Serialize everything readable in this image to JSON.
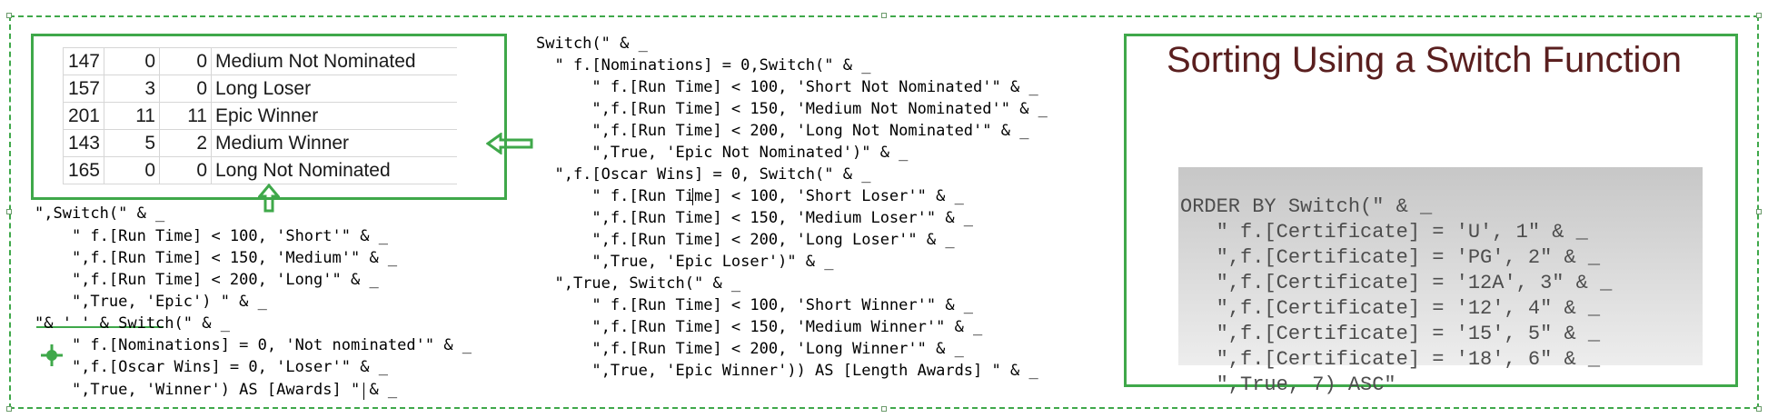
{
  "spreadsheet": {
    "rows": [
      [
        "147",
        "0",
        "0",
        "Medium Not Nominated"
      ],
      [
        "157",
        "3",
        "0",
        "Long Loser"
      ],
      [
        "201",
        "11",
        "11",
        "Epic Winner"
      ],
      [
        "143",
        "5",
        "2",
        "Medium Winner"
      ],
      [
        "165",
        "0",
        "0",
        "Long Not Nominated"
      ]
    ]
  },
  "left_code": [
    "\",Switch(\" & _",
    "    \" f.[Run Time] < 100, 'Short'\" & _",
    "    \",f.[Run Time] < 150, 'Medium'\" & _",
    "    \",f.[Run Time] < 200, 'Long'\" & _",
    "    \",True, 'Epic') \" & _",
    "\"& ' ' & Switch(\" & _",
    "    \" f.[Nominations] = 0, 'Not nominated'\" & _",
    "    \",f.[Oscar Wins] = 0, 'Loser'\" & _",
    "    \",True, 'Winner') AS [Awards] \" & _"
  ],
  "middle_code": [
    "Switch(\" & _",
    "  \" f.[Nominations] = 0,Switch(\" & _",
    "      \" f.[Run Time] < 100, 'Short Not Nominated'\" & _",
    "      \",f.[Run Time] < 150, 'Medium Not Nominated'\" & _",
    "      \",f.[Run Time] < 200, 'Long Not Nominated'\" & _",
    "      \",True, 'Epic Not Nominated')\" & _",
    "  \",f.[Oscar Wins] = 0, Switch(\" & _",
    "      \" f.[Run Time] < 100, 'Short Loser'\" & _",
    "      \",f.[Run Time] < 150, 'Medium Loser'\" & _",
    "      \",f.[Run Time] < 200, 'Long Loser'\" & _",
    "      \",True, 'Epic Loser')\" & _",
    "  \",True, Switch(\" & _",
    "      \" f.[Run Time] < 100, 'Short Winner'\" & _",
    "      \",f.[Run Time] < 150, 'Medium Winner'\" & _",
    "      \",f.[Run Time] < 200, 'Long Winner'\" & _",
    "      \",True, 'Epic Winner')) AS [Length Awards] \" & _"
  ],
  "slide": {
    "title": "Sorting Using a Switch Function",
    "code": [
      "ORDER BY Switch(\" & _",
      "   \" f.[Certificate] = 'U', 1\" & _",
      "   \",f.[Certificate] = 'PG', 2\" & _",
      "   \",f.[Certificate] = '12A', 3\" & _",
      "   \",f.[Certificate] = '12', 4\" & _",
      "   \",f.[Certificate] = '15', 5\" & _",
      "   \",f.[Certificate] = '18', 6\" & _",
      "   \",True, 7) ASC\""
    ]
  },
  "icons": [
    "arrow-left-icon",
    "arrow-up-icon",
    "crosshair-icon"
  ],
  "colors": {
    "border": "#3fa84a",
    "title": "#5a1f1f",
    "code_grey": "#4d4d4d"
  }
}
